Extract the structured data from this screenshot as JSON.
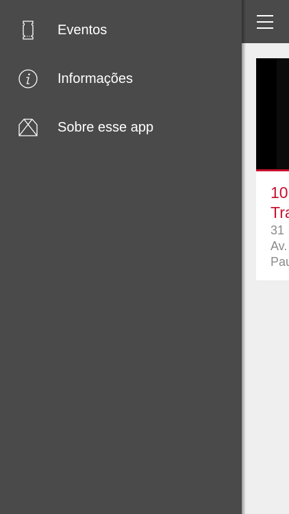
{
  "drawer": {
    "items": [
      {
        "label": "Eventos",
        "icon": "ticket-icon"
      },
      {
        "label": "Informações",
        "icon": "info-icon"
      },
      {
        "label": "Sobre esse app",
        "icon": "envelope-icon"
      }
    ]
  },
  "topbar": {
    "menu_icon": "hamburger-icon"
  },
  "event_card": {
    "title": "10\nTra",
    "info": "31 \nAv.\nPau"
  },
  "colors": {
    "drawer_bg": "#4a4a4a",
    "accent": "#c8102e",
    "content_bg": "#efefef",
    "text": "#ffffff"
  }
}
